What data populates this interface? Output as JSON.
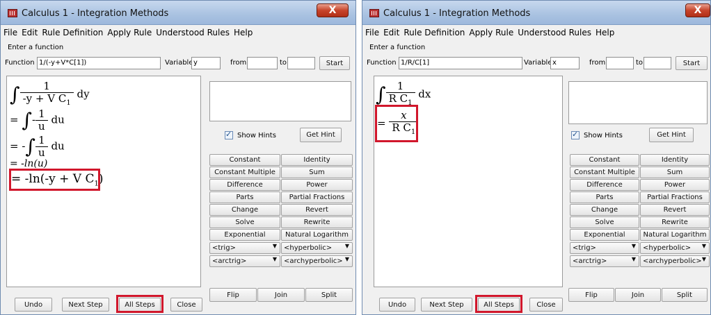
{
  "left": {
    "title": "Calculus 1 - Integration Methods",
    "close_glyph": "X",
    "menu": [
      "File",
      "Edit",
      "Rule Definition",
      "Apply Rule",
      "Understood Rules",
      "Help"
    ],
    "enter_label": "Enter a function",
    "function_label": "Function",
    "function_value": "1/(-y+V*C[1])",
    "variable_label": "Variable",
    "variable_value": "y",
    "from_label": "from",
    "from_value": "",
    "to_label": "to",
    "to_value": "",
    "start_label": "Start",
    "steps": {
      "line1_num": "1",
      "line1_den": "-y + V C",
      "line1_den_sub": "1",
      "line1_tail": "dy",
      "line2_prefix": "=",
      "line2_sign": "-",
      "line2_num": "1",
      "line2_den": "u",
      "line2_tail": "du",
      "line3_prefix": "= -",
      "line3_num": "1",
      "line3_den": "u",
      "line3_tail": "du",
      "line4": "= -ln(u)",
      "line5_main": "= -ln(-y + V C",
      "line5_sub": "1",
      "line5_close": ")"
    },
    "show_hints_label": "Show Hints",
    "get_hint_label": "Get Hint",
    "rules": [
      [
        "Constant",
        "Identity"
      ],
      [
        "Constant Multiple",
        "Sum"
      ],
      [
        "Difference",
        "Power"
      ],
      [
        "Parts",
        "Partial Fractions"
      ],
      [
        "Change",
        "Revert"
      ],
      [
        "Solve",
        "Rewrite"
      ],
      [
        "Exponential",
        "Natural Logarithm"
      ]
    ],
    "dropdowns": [
      [
        "<trig>",
        "<hyperbolic>"
      ],
      [
        "<arctrig>",
        "<archyperbolic>"
      ]
    ],
    "flip_label": "Flip",
    "join_label": "Join",
    "split_label": "Split",
    "undo_label": "Undo",
    "next_step_label": "Next Step",
    "all_steps_label": "All Steps",
    "close_label": "Close"
  },
  "right": {
    "title": "Calculus 1 - Integration Methods",
    "close_glyph": "X",
    "menu": [
      "File",
      "Edit",
      "Rule Definition",
      "Apply Rule",
      "Understood Rules",
      "Help"
    ],
    "enter_label": "Enter a function",
    "function_label": "Function",
    "function_value": "1/R/C[1]",
    "variable_label": "Variable",
    "variable_value": "x",
    "from_label": "from",
    "from_value": "",
    "to_label": "to",
    "to_value": "",
    "start_label": "Start",
    "steps": {
      "line1_num": "1",
      "line1_den": "R C",
      "line1_den_sub": "1",
      "line1_tail": "dx",
      "line2_prefix": "=",
      "line2_num": "x",
      "line2_den": "R C",
      "line2_den_sub": "1"
    },
    "show_hints_label": "Show Hints",
    "get_hint_label": "Get Hint",
    "rules": [
      [
        "Constant",
        "Identity"
      ],
      [
        "Constant Multiple",
        "Sum"
      ],
      [
        "Difference",
        "Power"
      ],
      [
        "Parts",
        "Partial Fractions"
      ],
      [
        "Change",
        "Revert"
      ],
      [
        "Solve",
        "Rewrite"
      ],
      [
        "Exponential",
        "Natural Logarithm"
      ]
    ],
    "dropdowns": [
      [
        "<trig>",
        "<hyperbolic>"
      ],
      [
        "<arctrig>",
        "<archyperbolic>"
      ]
    ],
    "flip_label": "Flip",
    "join_label": "Join",
    "split_label": "Split",
    "undo_label": "Undo",
    "next_step_label": "Next Step",
    "all_steps_label": "All Steps",
    "close_label": "Close"
  },
  "colors": {
    "highlight": "#d1172c",
    "title_bar": "#a9c2e1",
    "close_button": "#c7442b"
  }
}
